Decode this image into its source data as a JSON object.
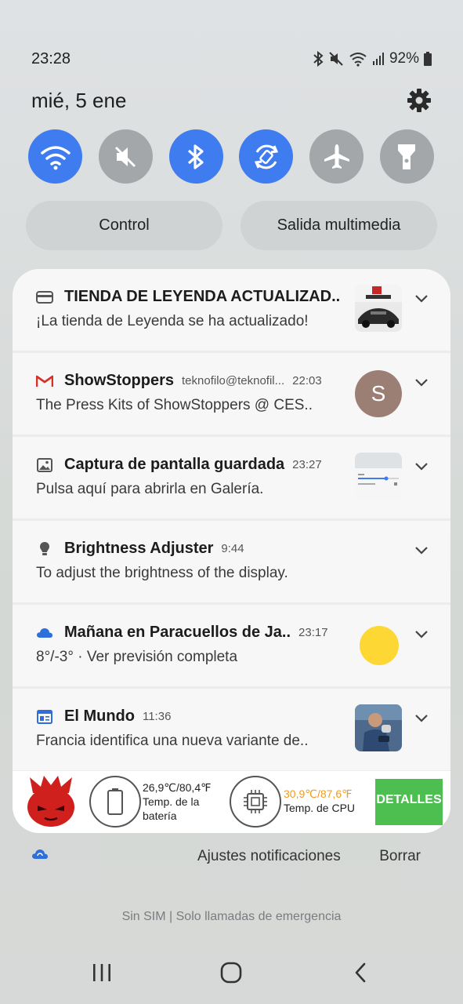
{
  "status_bar": {
    "time": "23:28",
    "battery": "92%",
    "icons": [
      "bluetooth-icon",
      "mute-icon",
      "wifi-icon",
      "signal-icon",
      "battery-icon"
    ]
  },
  "header": {
    "date": "mié, 5 ene",
    "settings_icon": "gear-icon"
  },
  "quick_settings": [
    {
      "name": "wifi",
      "icon": "wifi-icon",
      "state": "on"
    },
    {
      "name": "sound",
      "icon": "mute-icon",
      "state": "off"
    },
    {
      "name": "bluetooth",
      "icon": "bluetooth-icon",
      "state": "on"
    },
    {
      "name": "auto-rotate",
      "icon": "rotate-icon",
      "state": "on"
    },
    {
      "name": "airplane",
      "icon": "airplane-icon",
      "state": "off"
    },
    {
      "name": "flashlight",
      "icon": "flashlight-icon",
      "state": "off"
    }
  ],
  "pills": {
    "control": "Control",
    "media_output": "Salida multimedia"
  },
  "notifications": [
    {
      "title": "TIENDA DE LEYENDA ACTUALIZAD..",
      "body": "¡La tienda de Leyenda se ha actualizado!",
      "app_icon": "store-icon",
      "thumb": "asphalt-thumbnail"
    },
    {
      "title": "ShowStoppers",
      "sub": "teknofilo@teknofil...",
      "time": "22:03",
      "body": "The Press Kits of ShowStoppers @ CES..",
      "app_icon": "gmail-icon",
      "avatar_letter": "S"
    },
    {
      "title": "Captura de pantalla guardada",
      "time": "23:27",
      "body": "Pulsa aquí para abrirla en Galería.",
      "app_icon": "image-icon",
      "thumb": "screenshot-thumbnail"
    },
    {
      "title": "Brightness Adjuster",
      "time": "9:44",
      "body": "To adjust the brightness of the display.",
      "app_icon": "bulb-icon"
    },
    {
      "title": "Mañana en Paracuellos de Ja..",
      "time": "23:17",
      "body": "8°/-3° · Ver previsión completa",
      "app_icon": "cloud-icon",
      "thumb": "sun-icon"
    },
    {
      "title": "El Mundo",
      "time": "11:36",
      "body": "Francia identifica una nueva variante de..",
      "app_icon": "news-icon",
      "thumb": "news-thumbnail"
    }
  ],
  "widget": {
    "battery_temp": "26,9℃/80,4℉",
    "battery_label_1": "Temp. de la",
    "battery_label_2": "batería",
    "cpu_temp": "30,9℃/87,6℉",
    "cpu_label": "Temp. de CPU",
    "details_button": "DETALLES",
    "colors": {
      "cpu_temp": "#f39a1e",
      "details_bg": "#4cbf50"
    }
  },
  "bottom_actions": {
    "settings": "Ajustes notificaciones",
    "clear": "Borrar"
  },
  "carrier_text": "Sin SIM | Solo llamadas de emergencia",
  "nav": [
    "recents-icon",
    "home-icon",
    "back-icon"
  ],
  "colors": {
    "accent": "#3e7cf0",
    "tile_off": "#a3a7aa",
    "pill_bg": "#cfd3d4"
  }
}
